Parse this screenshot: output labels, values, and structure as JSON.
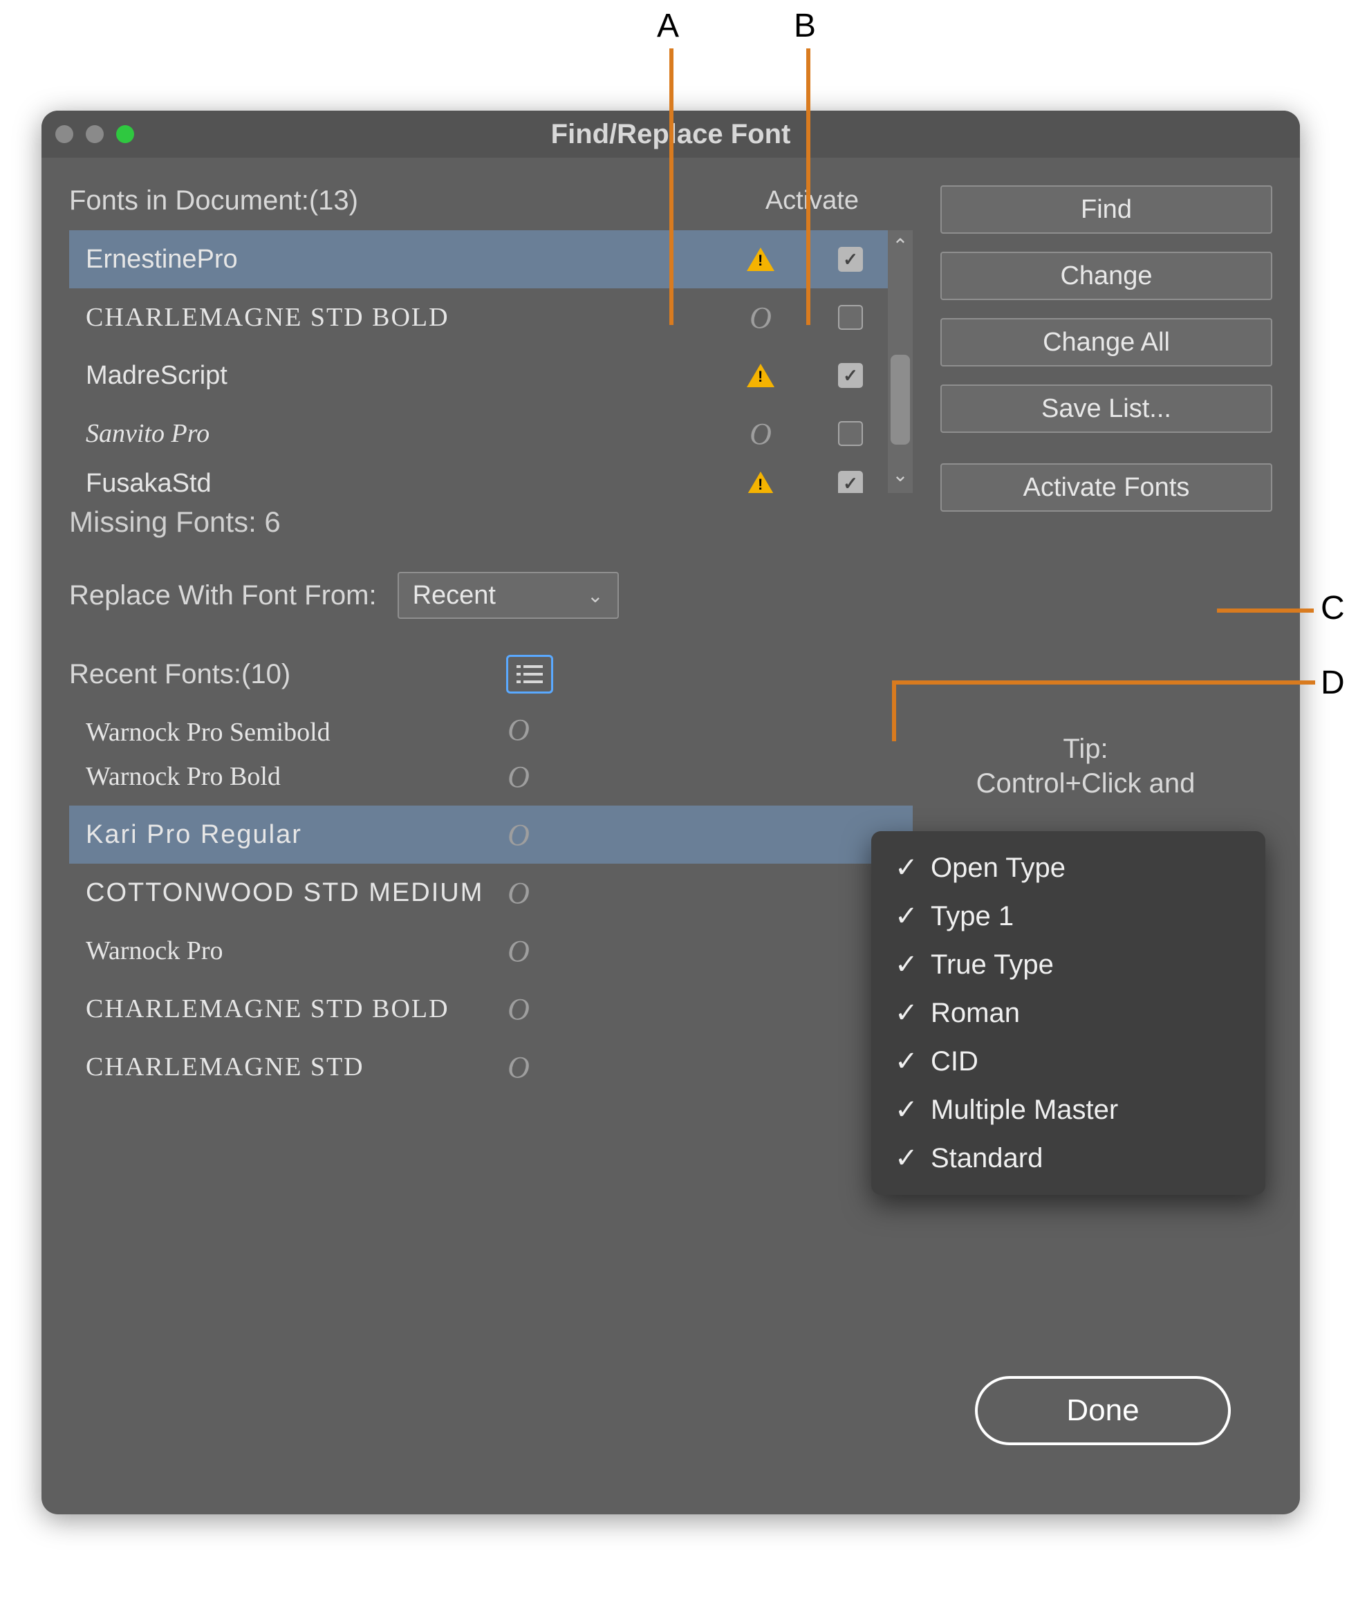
{
  "callouts": {
    "A": "A",
    "B": "B",
    "C": "C",
    "D": "D"
  },
  "dialog": {
    "title": "Find/Replace Font",
    "fonts_header": "Fonts in Document:(13)",
    "activate_header": "Activate",
    "missing_label": "Missing Fonts: 6",
    "replace_label": "Replace With Font From:",
    "replace_select": "Recent",
    "recent_header": "Recent Fonts:(10)",
    "tip_label": "Tip:",
    "tip_text": "Control+Click and",
    "done": "Done"
  },
  "buttons": {
    "find": "Find",
    "change": "Change",
    "change_all": "Change All",
    "save_list": "Save List...",
    "activate_fonts": "Activate Fonts"
  },
  "doc_fonts": [
    {
      "name": "ErnestinePro",
      "status": "warning",
      "activate": true,
      "selected": true,
      "cls": ""
    },
    {
      "name": "CHARLEMAGNE STD BOLD",
      "status": "ok",
      "activate": false,
      "selected": false,
      "cls": "fn-sample-smallcaps"
    },
    {
      "name": "MadreScript",
      "status": "warning",
      "activate": true,
      "selected": false,
      "cls": ""
    },
    {
      "name": "Sanvito Pro",
      "status": "ok",
      "activate": false,
      "selected": false,
      "cls": "fn-sample-italic"
    },
    {
      "name": "FusakaStd",
      "status": "warning",
      "activate": true,
      "selected": false,
      "cls": "",
      "cut": true
    }
  ],
  "recent_fonts": [
    {
      "name": "Warnock Pro Semibold",
      "selected": false,
      "cls": "fn-sample-serif",
      "cut_top": true
    },
    {
      "name": "Warnock Pro Bold",
      "selected": false,
      "cls": "fn-sample-serif"
    },
    {
      "name": "Kari Pro Regular",
      "selected": true,
      "cls": "fn-sample-display"
    },
    {
      "name": "COTTONWOOD STD MEDIUM",
      "selected": false,
      "cls": "fn-sample-display"
    },
    {
      "name": "Warnock Pro",
      "selected": false,
      "cls": "fn-sample-serif"
    },
    {
      "name": "CHARLEMAGNE STD BOLD",
      "selected": false,
      "cls": "fn-sample-smallcaps"
    },
    {
      "name": "CHARLEMAGNE STD",
      "selected": false,
      "cls": "fn-sample-smallcaps"
    }
  ],
  "filter_menu": [
    "Open Type",
    "Type 1",
    "True Type",
    "Roman",
    "CID",
    "Multiple Master",
    "Standard"
  ]
}
